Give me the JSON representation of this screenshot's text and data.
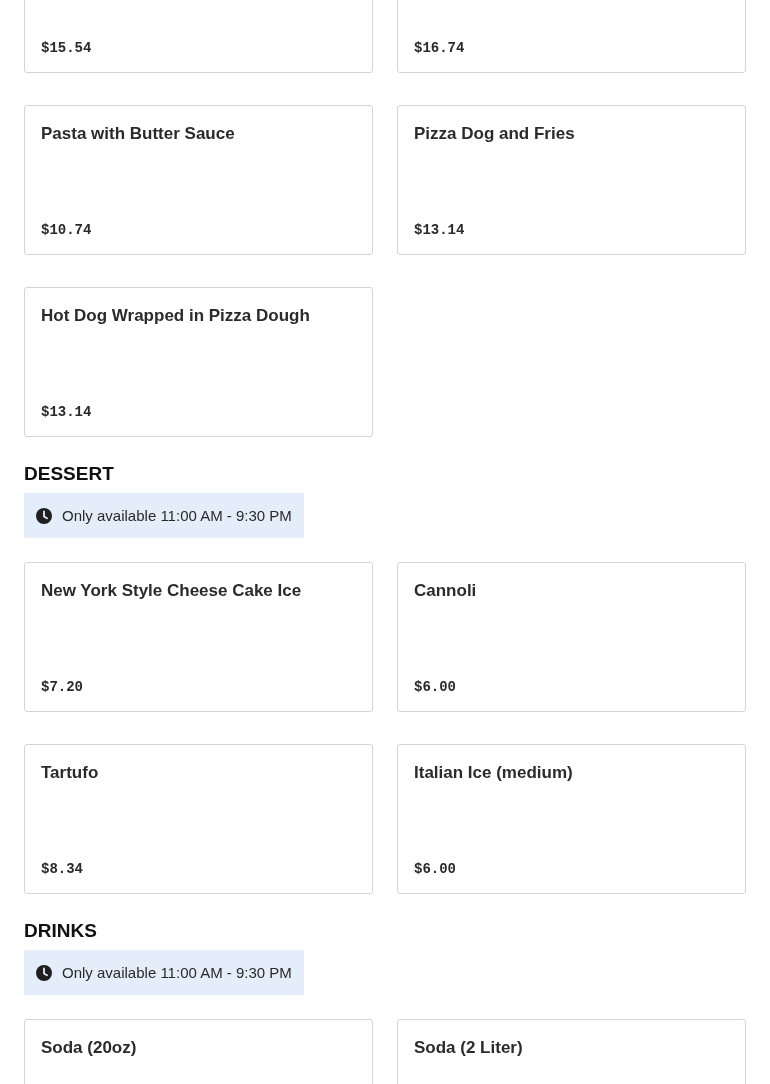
{
  "sections": [
    {
      "items": [
        {
          "price": "$15.54"
        },
        {
          "price": "$16.74"
        },
        {
          "title": "Pasta with Butter Sauce",
          "price": "$10.74"
        },
        {
          "title": "Pizza Dog and Fries",
          "price": "$13.14"
        },
        {
          "title": "Hot Dog Wrapped in Pizza Dough",
          "price": "$13.14"
        }
      ]
    },
    {
      "heading": "DESSERT",
      "badge": "Only available 11:00 AM - 9:30 PM",
      "items": [
        {
          "title": "New York Style Cheese Cake Ice",
          "price": "$7.20"
        },
        {
          "title": "Cannoli",
          "price": "$6.00"
        },
        {
          "title": "Tartufo",
          "price": "$8.34"
        },
        {
          "title": "Italian Ice (medium)",
          "price": "$6.00"
        }
      ]
    },
    {
      "heading": "DRINKS",
      "badge": "Only available 11:00 AM - 9:30 PM",
      "items": [
        {
          "title": "Soda (20oz)"
        },
        {
          "title": "Soda (2 Liter)"
        }
      ]
    }
  ]
}
